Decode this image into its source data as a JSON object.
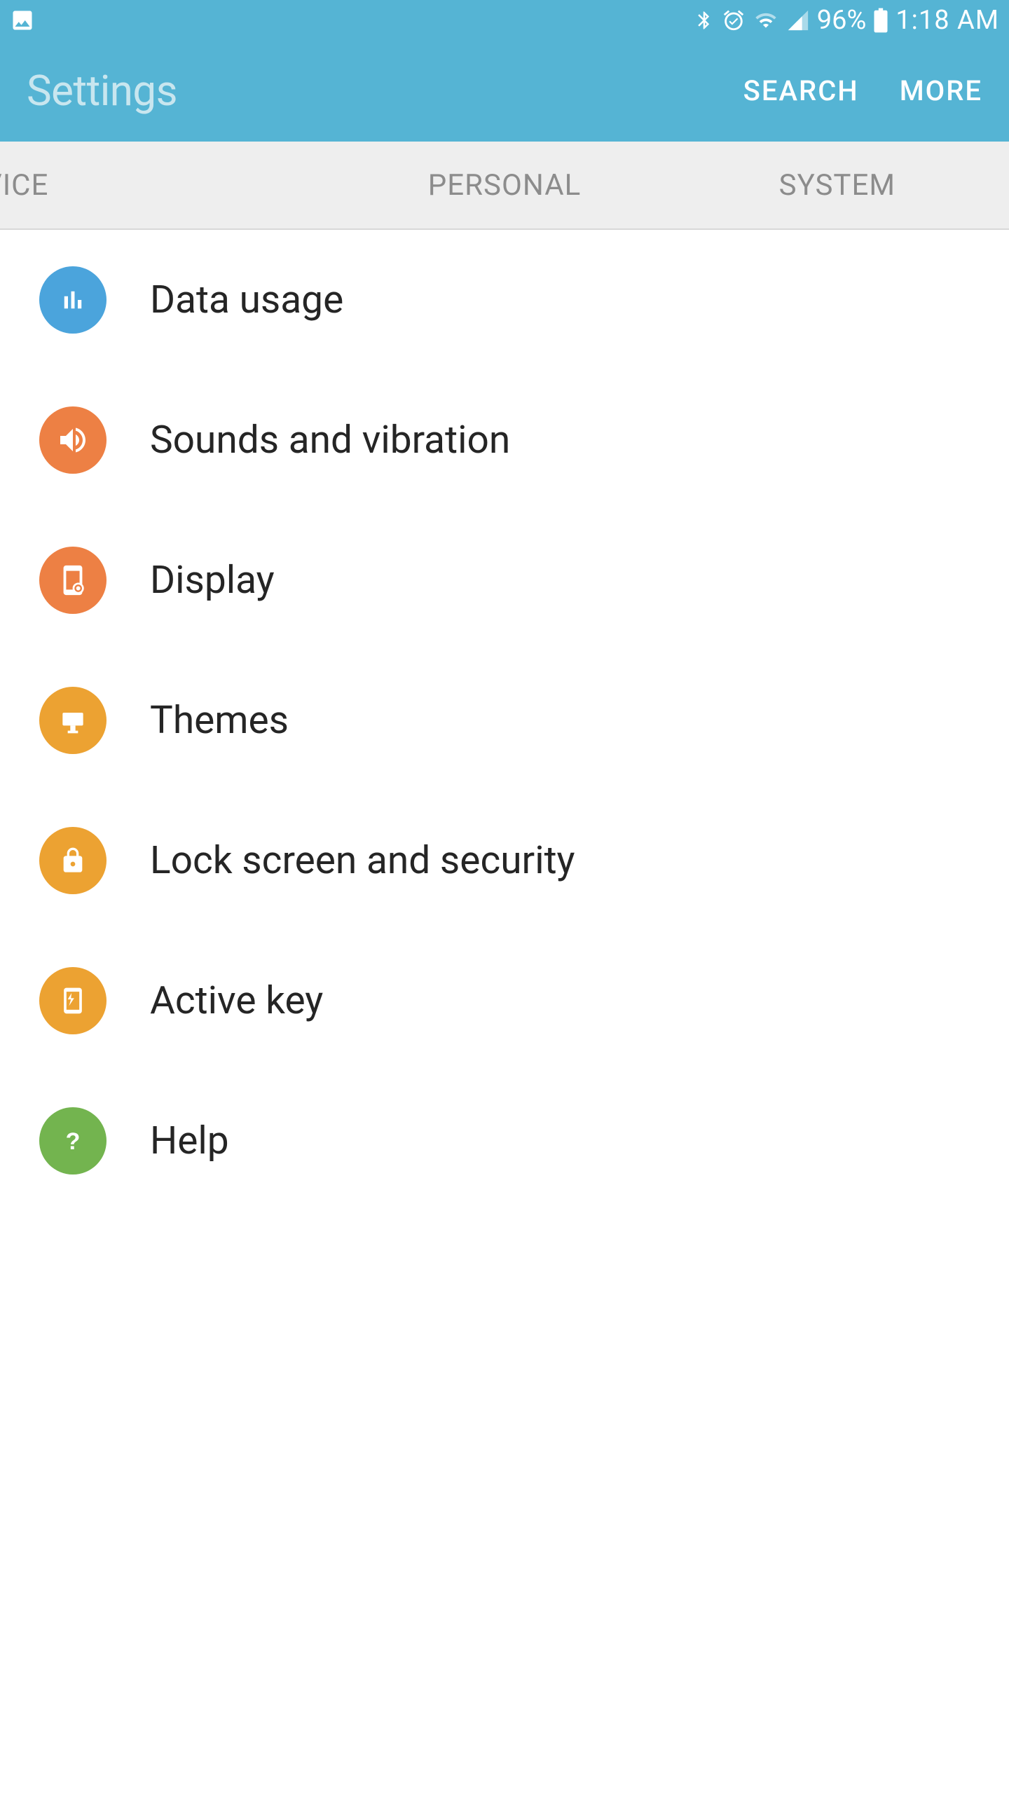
{
  "status": {
    "battery_pct": "96%",
    "time": "1:18 AM"
  },
  "header": {
    "title": "Settings",
    "search": "SEARCH",
    "more": "MORE"
  },
  "tabs": {
    "t1": "VICE",
    "t2": "PERSONAL",
    "t3": "SYSTEM"
  },
  "items": [
    {
      "label": "Data usage"
    },
    {
      "label": "Sounds and vibration"
    },
    {
      "label": "Display"
    },
    {
      "label": "Themes"
    },
    {
      "label": "Lock screen and security"
    },
    {
      "label": "Active key"
    },
    {
      "label": "Help"
    }
  ]
}
